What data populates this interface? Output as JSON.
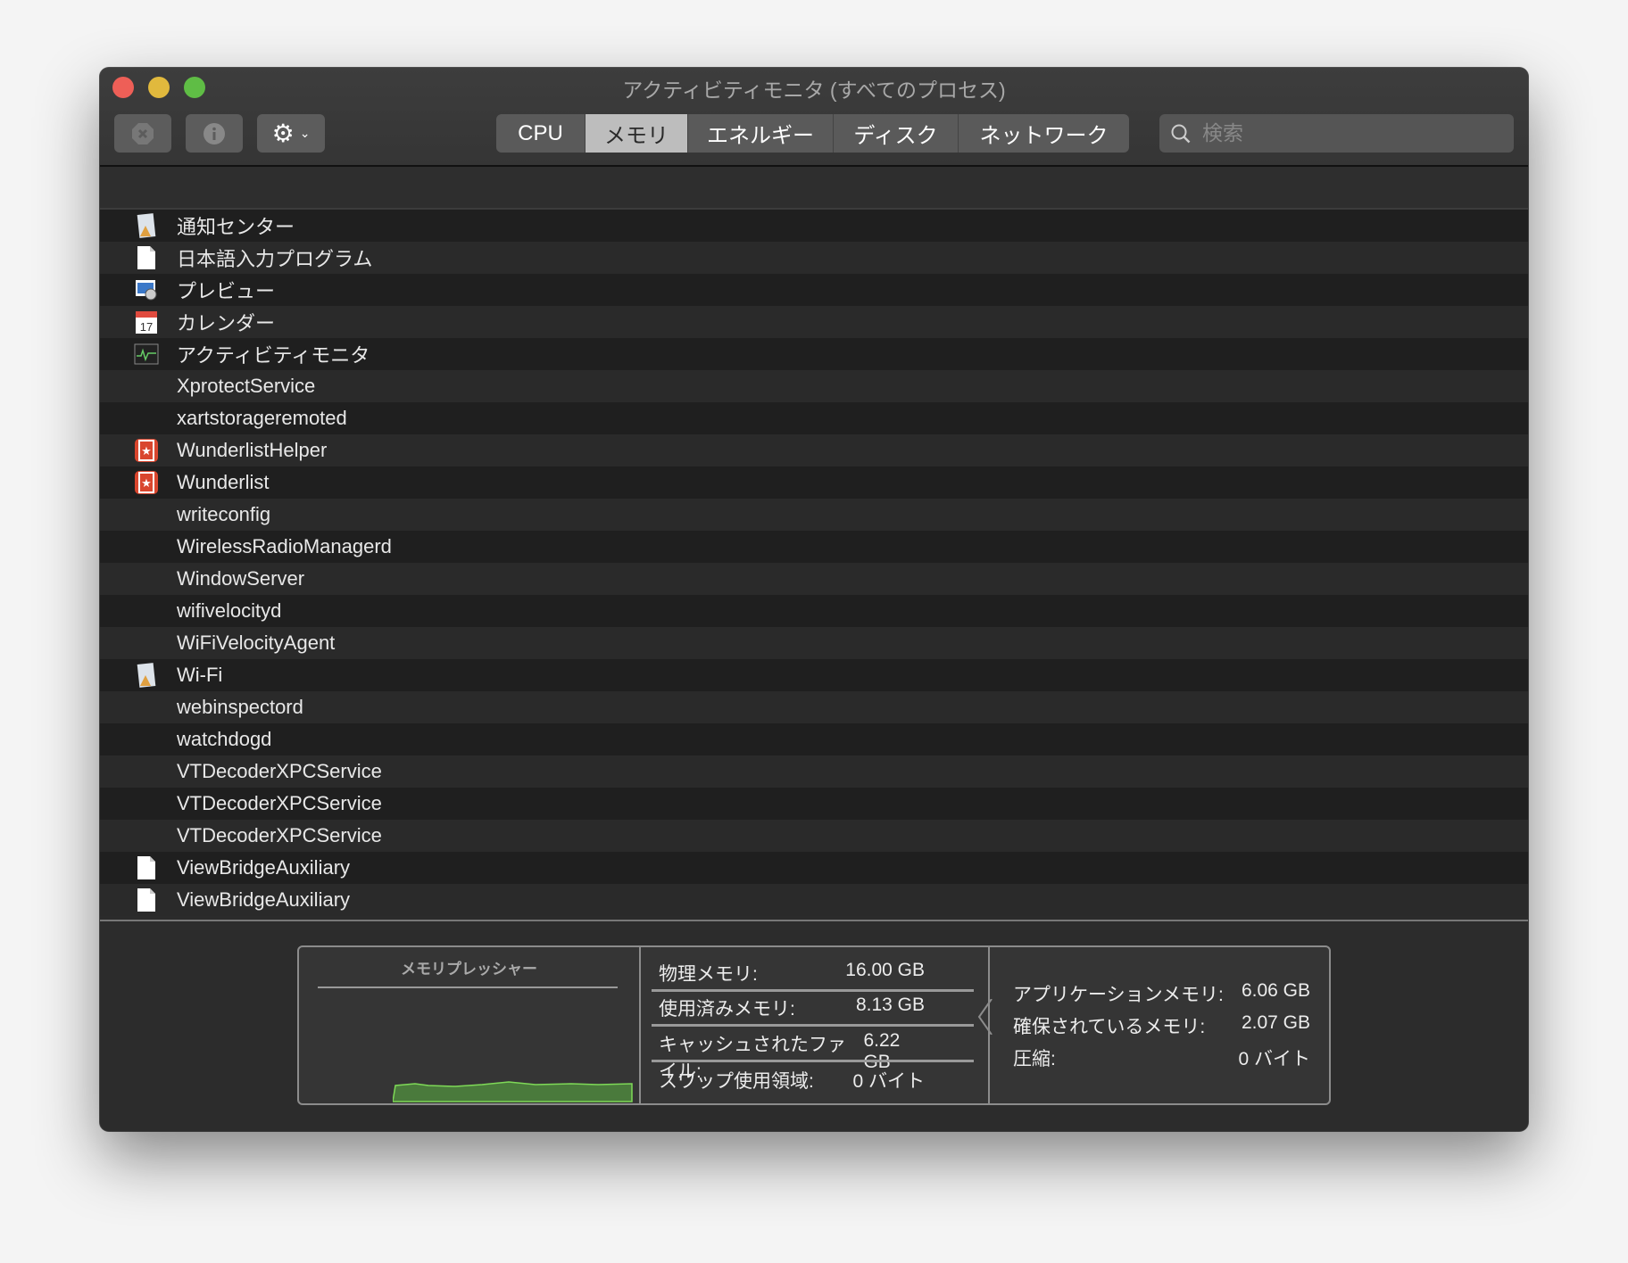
{
  "window": {
    "title": "アクティビティモニタ (すべてのプロセス)"
  },
  "toolbar": {
    "stop_icon": "x-octagon-icon",
    "info_icon": "info-icon",
    "gear_icon": "gear-icon",
    "tabs": [
      "CPU",
      "メモリ",
      "エネルギー",
      "ディスク",
      "ネットワーク"
    ],
    "active_tab": "メモリ",
    "search_placeholder": "検索"
  },
  "processes": [
    {
      "name": "通知センター",
      "icon": "app-generic"
    },
    {
      "name": "日本語入力プログラム",
      "icon": "doc"
    },
    {
      "name": "プレビュー",
      "icon": "preview"
    },
    {
      "name": "カレンダー",
      "icon": "calendar"
    },
    {
      "name": "アクティビティモニタ",
      "icon": "activity"
    },
    {
      "name": "XprotectService",
      "icon": ""
    },
    {
      "name": "xartstorageremoted",
      "icon": ""
    },
    {
      "name": "WunderlistHelper",
      "icon": "wunderlist"
    },
    {
      "name": "Wunderlist",
      "icon": "wunderlist"
    },
    {
      "name": "writeconfig",
      "icon": ""
    },
    {
      "name": "WirelessRadioManagerd",
      "icon": ""
    },
    {
      "name": "WindowServer",
      "icon": ""
    },
    {
      "name": "wifivelocityd",
      "icon": ""
    },
    {
      "name": "WiFiVelocityAgent",
      "icon": ""
    },
    {
      "name": "Wi-Fi",
      "icon": "app-generic"
    },
    {
      "name": "webinspectord",
      "icon": ""
    },
    {
      "name": "watchdogd",
      "icon": ""
    },
    {
      "name": "VTDecoderXPCService",
      "icon": ""
    },
    {
      "name": "VTDecoderXPCService",
      "icon": ""
    },
    {
      "name": "VTDecoderXPCService",
      "icon": ""
    },
    {
      "name": "ViewBridgeAuxiliary",
      "icon": "doc"
    },
    {
      "name": "ViewBridgeAuxiliary",
      "icon": "doc"
    }
  ],
  "memory": {
    "pressure_title": "メモリプレッシャー",
    "pressure_color": "#4a7a3c",
    "stats": [
      {
        "label": "物理メモリ:",
        "value": "16.00 GB"
      },
      {
        "label": "使用済みメモリ:",
        "value": "8.13 GB"
      },
      {
        "label": "キャッシュされたファイル:",
        "value": "6.22 GB"
      },
      {
        "label": "スワップ使用領域:",
        "value": "0 バイト"
      }
    ],
    "breakdown": [
      {
        "label": "アプリケーションメモリ:",
        "value": "6.06 GB"
      },
      {
        "label": "確保されているメモリ:",
        "value": "2.07 GB"
      },
      {
        "label": "圧縮:",
        "value": "0 バイト"
      }
    ]
  }
}
